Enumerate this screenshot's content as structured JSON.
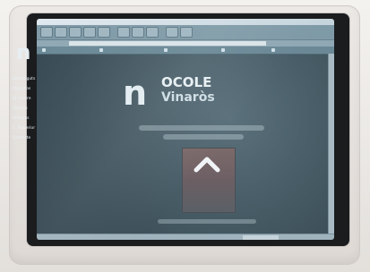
{
  "brand": {
    "logo_letter": "n",
    "name_line1": "OCOLE",
    "name_line2": "Vinaròs"
  },
  "sidebar": {
    "logo_letter": "n",
    "items": [
      {
        "label": "Benvinguts"
      },
      {
        "label": "Aparatos"
      },
      {
        "label": "El Centre"
      },
      {
        "label": "Vinaròs"
      },
      {
        "label": "Enllaços"
      },
      {
        "label": "C. Superior"
      },
      {
        "label": "Contacte"
      }
    ]
  },
  "colors": {
    "screen_bg": "#3b4e58",
    "accent_logo": "#7c6a6a"
  },
  "icons": {
    "logo_mark": "chevron-up-icon"
  }
}
